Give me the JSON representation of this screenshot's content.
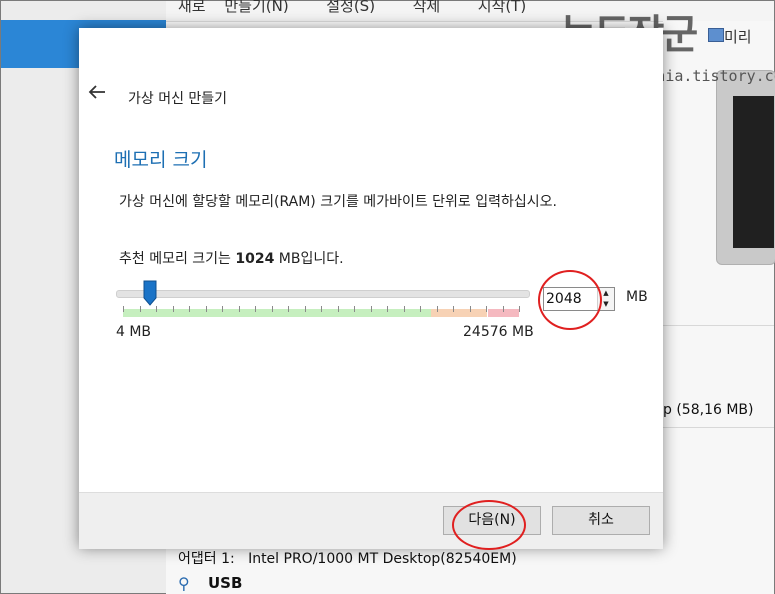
{
  "background": {
    "menu_text": "새로 만들기(N)  설정(S)  삭제  시작(T)",
    "disk_size": "p (58,16 MB)",
    "adapter": "어댑터 1:   Intel PRO/1000 MT Desktop(82540EM)",
    "usb_label": "USB",
    "usb_icon": "usb-icon",
    "preview_label": "미리"
  },
  "watermark": {
    "title": "녹두장군",
    "url": "http://mainia.tistory.com"
  },
  "dialog": {
    "title": "가상 머신 만들기",
    "back_icon": "back-arrow-icon",
    "section_title": "메모리 크기",
    "description": "가상 머신에 할당할 메모리(RAM) 크기를 메가바이트 단위로 입력하십시오.",
    "recommend_prefix": "추천 메모리 크기는 ",
    "recommend_value": "1024",
    "recommend_suffix": " MB입니다.",
    "slider": {
      "min_label": "4 MB",
      "max_label": "24576 MB",
      "min_mb": 4,
      "max_mb": 24576,
      "value_mb": 2048,
      "green_until_fraction": 0.76,
      "orange_until_fraction": 0.9
    },
    "memory_input": {
      "value": "2048"
    },
    "unit": "MB",
    "buttons": {
      "next": "다음(N)",
      "cancel": "취소"
    }
  },
  "colors": {
    "accent": "#1d6fb3",
    "annotation": "#e02020",
    "slider_handle": "#1a73c7"
  }
}
